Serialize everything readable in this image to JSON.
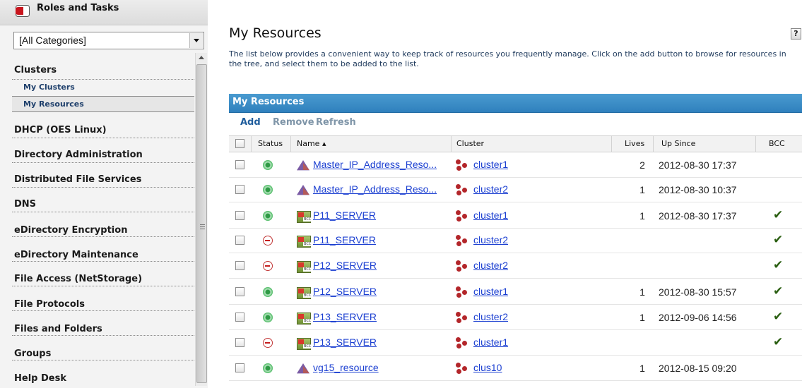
{
  "sidebar": {
    "title": "Roles and Tasks",
    "category_select": {
      "value": "[All Categories]"
    },
    "items": [
      {
        "label": "Clusters"
      },
      {
        "label": "My Clusters"
      },
      {
        "label": "My Resources"
      },
      {
        "label": "DHCP (OES Linux)"
      },
      {
        "label": "Directory Administration"
      },
      {
        "label": "Distributed File Services"
      },
      {
        "label": "DNS"
      },
      {
        "label": "eDirectory Encryption"
      },
      {
        "label": "eDirectory Maintenance"
      },
      {
        "label": "File Access (NetStorage)"
      },
      {
        "label": "File Protocols"
      },
      {
        "label": "Files and Folders"
      },
      {
        "label": "Groups"
      },
      {
        "label": "Help Desk"
      }
    ]
  },
  "page": {
    "title": "My Resources",
    "help_label": "?",
    "description": "The list below provides a convenient way to keep track of resources you frequently manage. Click on the add button to browse for resources in the tree, and select them to be added to the list."
  },
  "panel": {
    "title": "My Resources",
    "toolbar": {
      "add": "Add",
      "remove": "Remove",
      "refresh": "Refresh"
    },
    "columns": {
      "status": "Status",
      "name": "Name ▴",
      "cluster": "Cluster",
      "lives": "Lives",
      "up_since": "Up Since",
      "bcc": "BCC"
    },
    "rows": [
      {
        "status": "running",
        "icon": "ip-resource-icon",
        "name": "Master_IP_Address_Reso...",
        "cluster": "cluster1",
        "lives": "2",
        "up_since": "2012-08-30 17:37",
        "bcc": ""
      },
      {
        "status": "running",
        "icon": "ip-resource-icon",
        "name": "Master_IP_Address_Reso...",
        "cluster": "cluster2",
        "lives": "1",
        "up_since": "2012-08-30 10:37",
        "bcc": ""
      },
      {
        "status": "running",
        "icon": "bcc-server-icon",
        "name": "P11_SERVER",
        "cluster": "cluster1",
        "lives": "1",
        "up_since": "2012-08-30 17:37",
        "bcc": "✔"
      },
      {
        "status": "offline",
        "icon": "bcc-server-icon",
        "name": "P11_SERVER",
        "cluster": "cluster2",
        "lives": "",
        "up_since": "",
        "bcc": "✔"
      },
      {
        "status": "offline",
        "icon": "bcc-server-icon",
        "name": "P12_SERVER",
        "cluster": "cluster2",
        "lives": "",
        "up_since": "",
        "bcc": "✔"
      },
      {
        "status": "running",
        "icon": "bcc-server-icon",
        "name": "P12_SERVER",
        "cluster": "cluster1",
        "lives": "1",
        "up_since": "2012-08-30 15:57",
        "bcc": "✔"
      },
      {
        "status": "running",
        "icon": "bcc-server-icon",
        "name": "P13_SERVER",
        "cluster": "cluster2",
        "lives": "1",
        "up_since": "2012-09-06 14:56",
        "bcc": "✔"
      },
      {
        "status": "offline",
        "icon": "bcc-server-icon",
        "name": "P13_SERVER",
        "cluster": "cluster1",
        "lives": "",
        "up_since": "",
        "bcc": "✔"
      },
      {
        "status": "running",
        "icon": "ip-resource-icon",
        "name": "vg15_resource",
        "cluster": "clus10",
        "lives": "1",
        "up_since": "2012-08-15 09:20",
        "bcc": ""
      }
    ]
  },
  "colors": {
    "header_blue": "#2f80bd",
    "link_blue": "#1b3fd1",
    "status_green": "#49b85f",
    "status_red": "#c23737",
    "check_green": "#2b5f12"
  }
}
